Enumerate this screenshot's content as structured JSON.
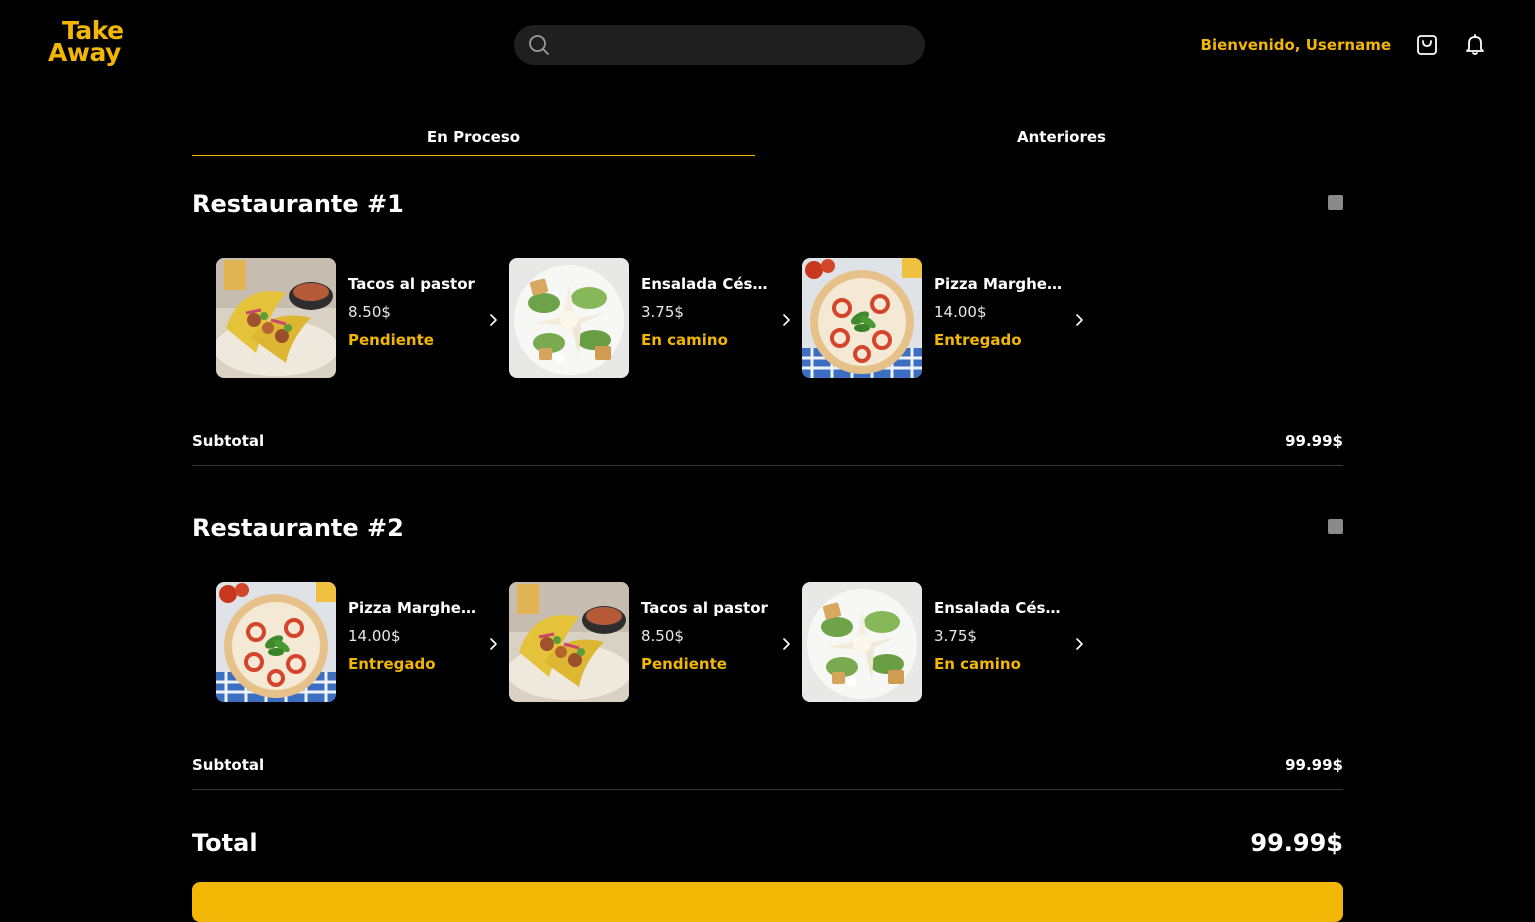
{
  "header": {
    "logo_line1": "Take",
    "logo_line2": "Away",
    "search_placeholder": "",
    "welcome": "Bienvenido, Username"
  },
  "tabs": [
    {
      "label": "En Proceso",
      "active": true
    },
    {
      "label": "Anteriores",
      "active": false
    }
  ],
  "restaurants": [
    {
      "name": "Restaurante #1",
      "items": [
        {
          "name": "Tacos al pastor",
          "price": "8.50$",
          "status": "Pendiente",
          "image": "tacos"
        },
        {
          "name": "Ensalada César",
          "price": "3.75$",
          "status": "En camino",
          "image": "salad"
        },
        {
          "name": "Pizza Margheri…",
          "price": "14.00$",
          "status": "Entregado",
          "image": "pizza"
        }
      ],
      "subtotal_label": "Subtotal",
      "subtotal": "99.99$"
    },
    {
      "name": "Restaurante #2",
      "items": [
        {
          "name": "Pizza Margheri…",
          "price": "14.00$",
          "status": "Entregado",
          "image": "pizza"
        },
        {
          "name": "Tacos al pastor",
          "price": "8.50$",
          "status": "Pendiente",
          "image": "tacos"
        },
        {
          "name": "Ensalada César",
          "price": "3.75$",
          "status": "En camino",
          "image": "salad"
        }
      ],
      "subtotal_label": "Subtotal",
      "subtotal": "99.99$"
    }
  ],
  "total_label": "Total",
  "total": "99.99$",
  "colors": {
    "accent": "#f2b705",
    "background": "#000000"
  }
}
